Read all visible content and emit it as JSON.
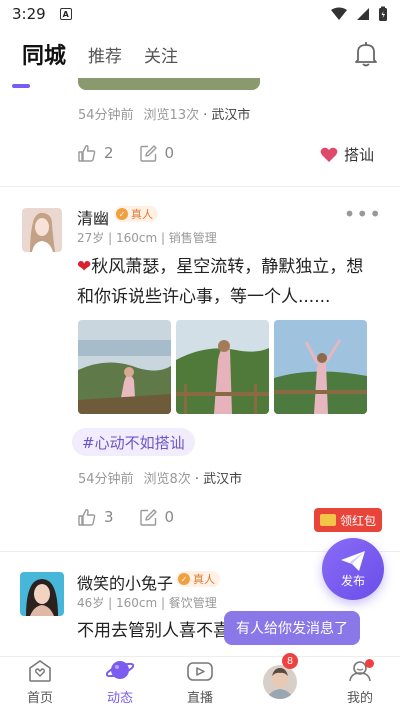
{
  "status_bar": {
    "time": "3:29",
    "app_icon_letter": "A"
  },
  "top_tabs": [
    {
      "label": "同城",
      "active": true
    },
    {
      "label": "推荐",
      "active": false
    },
    {
      "label": "关注",
      "active": false
    }
  ],
  "prev_post": {
    "time_ago": "54分钟前",
    "views": "浏览13次",
    "city_sep": "·",
    "city": "武汉市",
    "likes": "2",
    "comments": "0",
    "chat_label": "搭讪"
  },
  "post": {
    "username": "清幽",
    "badge": "真人",
    "profile": "27岁 | 160cm | 销售管理",
    "more": "•••",
    "text_heart": "❤",
    "text": "秋风萧瑟，星空流转，静默独立，想和你诉说些许心事，等一个人......",
    "topic": "#心动不如搭讪",
    "time_ago": "54分钟前",
    "views": "浏览8次",
    "city_sep": "·",
    "city": "武汉市",
    "likes": "3",
    "comments": "0"
  },
  "next_post": {
    "username": "微笑的小兔子",
    "badge": "真人",
    "profile": "46岁 | 160cm | 餐饮管理",
    "text": "不用去管别人喜不喜"
  },
  "red_packet": {
    "label": "领红包"
  },
  "fab": {
    "label": "发布"
  },
  "toast": {
    "text": "有人给你发消息了"
  },
  "bottom_nav": [
    {
      "label": "首页",
      "icon": "home-icon",
      "active": false
    },
    {
      "label": "动态",
      "icon": "planet-icon",
      "active": true
    },
    {
      "label": "直播",
      "icon": "video-icon",
      "active": false
    },
    {
      "label": "",
      "icon": "avatar",
      "badge": "8",
      "active": false
    },
    {
      "label": "我的",
      "icon": "profile-icon",
      "active": false
    }
  ],
  "colors": {
    "accent": "#7b5cf0",
    "badge_red": "#f04040",
    "heart": "#e04a6a"
  }
}
